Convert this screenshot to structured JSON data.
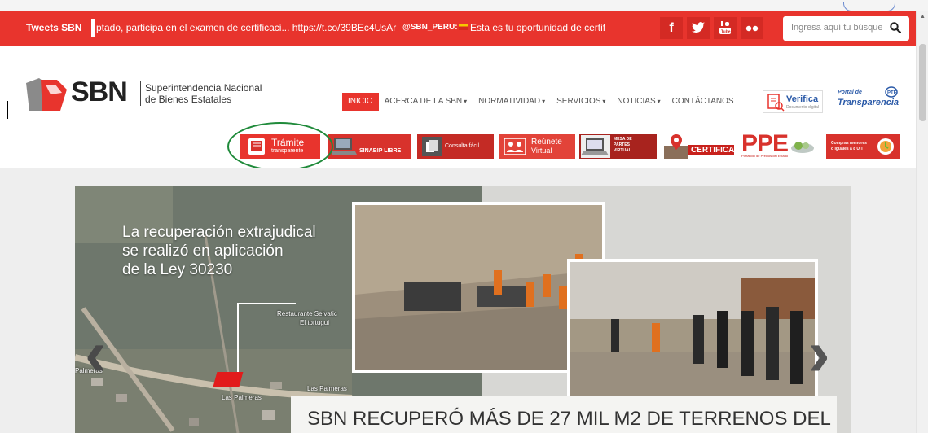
{
  "topbar": {
    "tweets_label": "Tweets SBN",
    "ticker_1": "ptado, participa en el examen de certificaci... https://t.co/39BEc4UsAr",
    "ticker_handle": "@SBN_PERU:",
    "ticker_2": "Esta es tu oportunidad de certifi",
    "social": [
      "f",
      "t",
      "You Tube",
      "flickr"
    ],
    "search_placeholder": "Ingresa aquí tu búsque"
  },
  "header": {
    "logo_text": "SBN",
    "logo_line1": "Superintendencia Nacional",
    "logo_line2": "de Bienes Estatales",
    "nav": [
      {
        "label": "INICIO",
        "caret": false
      },
      {
        "label": "ACERCA DE LA SBN",
        "caret": true
      },
      {
        "label": "NORMATIVIDAD",
        "caret": true
      },
      {
        "label": "SERVICIOS",
        "caret": true
      },
      {
        "label": "NOTICIAS",
        "caret": true
      },
      {
        "label": "CONTÁCTANOS",
        "caret": false
      }
    ],
    "verifica_title": "Verifica",
    "verifica_sub": "Documento digital",
    "portal_line1": "Portal de",
    "portal_line2": "Transparencia"
  },
  "banners": {
    "tramite_1": "Trámite",
    "tramite_2": "transparente",
    "sinabip": "SINABIP LIBRE",
    "consulta": "Consulta fácil",
    "reunete_1": "Reúnete",
    "reunete_2": "Virtual",
    "mesa": "MESA DE PARTES VIRTUAL",
    "certi": "CERTIFICAT",
    "ppe": "PPE",
    "ppe_sub": "Portafolio de Predios del Estado",
    "compras": "Compras menores o iguales a 8 UIT"
  },
  "hero": {
    "line1": "La recuperación extrajudical",
    "line2": "se realizó en aplicación",
    "line3": "de la Ley 30230",
    "map_labels": [
      "Restaurante Selvatic",
      "El tortugui",
      "Las Palmeras",
      "Las Palmeras",
      "Palmeras"
    ],
    "caption": "SBN RECUPERÓ MÁS DE 27 MIL M2 DE TERRENOS DEL"
  },
  "colors": {
    "brand_red": "#e8342d",
    "highlight_green": "#1f8a3a",
    "link_blue": "#2b5aa8"
  }
}
